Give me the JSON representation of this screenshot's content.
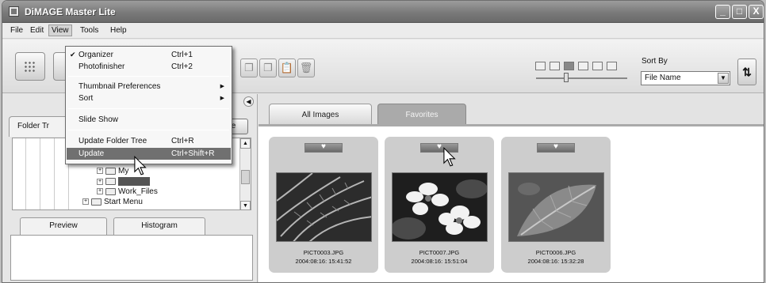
{
  "window": {
    "title": "DiMAGE Master Lite"
  },
  "window_controls": [
    "_",
    "□",
    "X"
  ],
  "menubar": {
    "items": [
      {
        "label": "File",
        "open": false
      },
      {
        "label": "Edit",
        "open": false
      },
      {
        "label": "View",
        "open": true
      },
      {
        "label": "Tools",
        "open": false
      },
      {
        "label": "Help",
        "open": false
      }
    ]
  },
  "view_menu": {
    "items": [
      {
        "label": "Organizer",
        "shortcut": "Ctrl+1",
        "checked": true
      },
      {
        "label": "Photofinisher",
        "shortcut": "Ctrl+2"
      },
      {
        "label": "Thumbnail Preferences",
        "submenu": true
      },
      {
        "label": "Sort",
        "submenu": true
      },
      {
        "label": "Slide Show"
      },
      {
        "label": "Update Folder Tree",
        "shortcut": "Ctrl+R"
      },
      {
        "label": "Update",
        "shortcut": "Ctrl+Shift+R",
        "highlighted": true
      }
    ]
  },
  "toolbar": {
    "sort_by_label": "Sort By",
    "sort_by_value": "File Name",
    "thumbnail_size_level": 0.33,
    "icons": [
      "organizer-view-icon",
      "copy-icon",
      "paste-icon",
      "delete-icon",
      "sort-order-icon"
    ]
  },
  "left_pane": {
    "folder_tab_label": "Folder Tr",
    "tree_button_label": "te",
    "tree_items": [
      {
        "label": "My",
        "selected": false
      },
      {
        "label": "",
        "selected": true
      },
      {
        "label": "Work_Files",
        "selected": false
      },
      {
        "label": "Start Menu",
        "selected": false
      }
    ],
    "bottom_tabs": [
      "Preview",
      "Histogram"
    ]
  },
  "gallery": {
    "tabs": [
      {
        "label": "All Images",
        "active": false
      },
      {
        "label": "Favorites",
        "active": true
      }
    ],
    "thumbnails": [
      {
        "filename": "PICT0003.JPG",
        "date": "2004:08:16: 15:41:52",
        "subject": "fern-frond"
      },
      {
        "filename": "PICT0007.JPG",
        "date": "2004:08:16: 15:51:04",
        "subject": "white-flowers"
      },
      {
        "filename": "PICT0006.JPG",
        "date": "2004:08:16: 15:32:28",
        "subject": "leaf"
      }
    ]
  },
  "colors": {
    "selection": "#707070",
    "titlebar": "#7a7a7a",
    "active_tab": "#aaaaaa"
  }
}
